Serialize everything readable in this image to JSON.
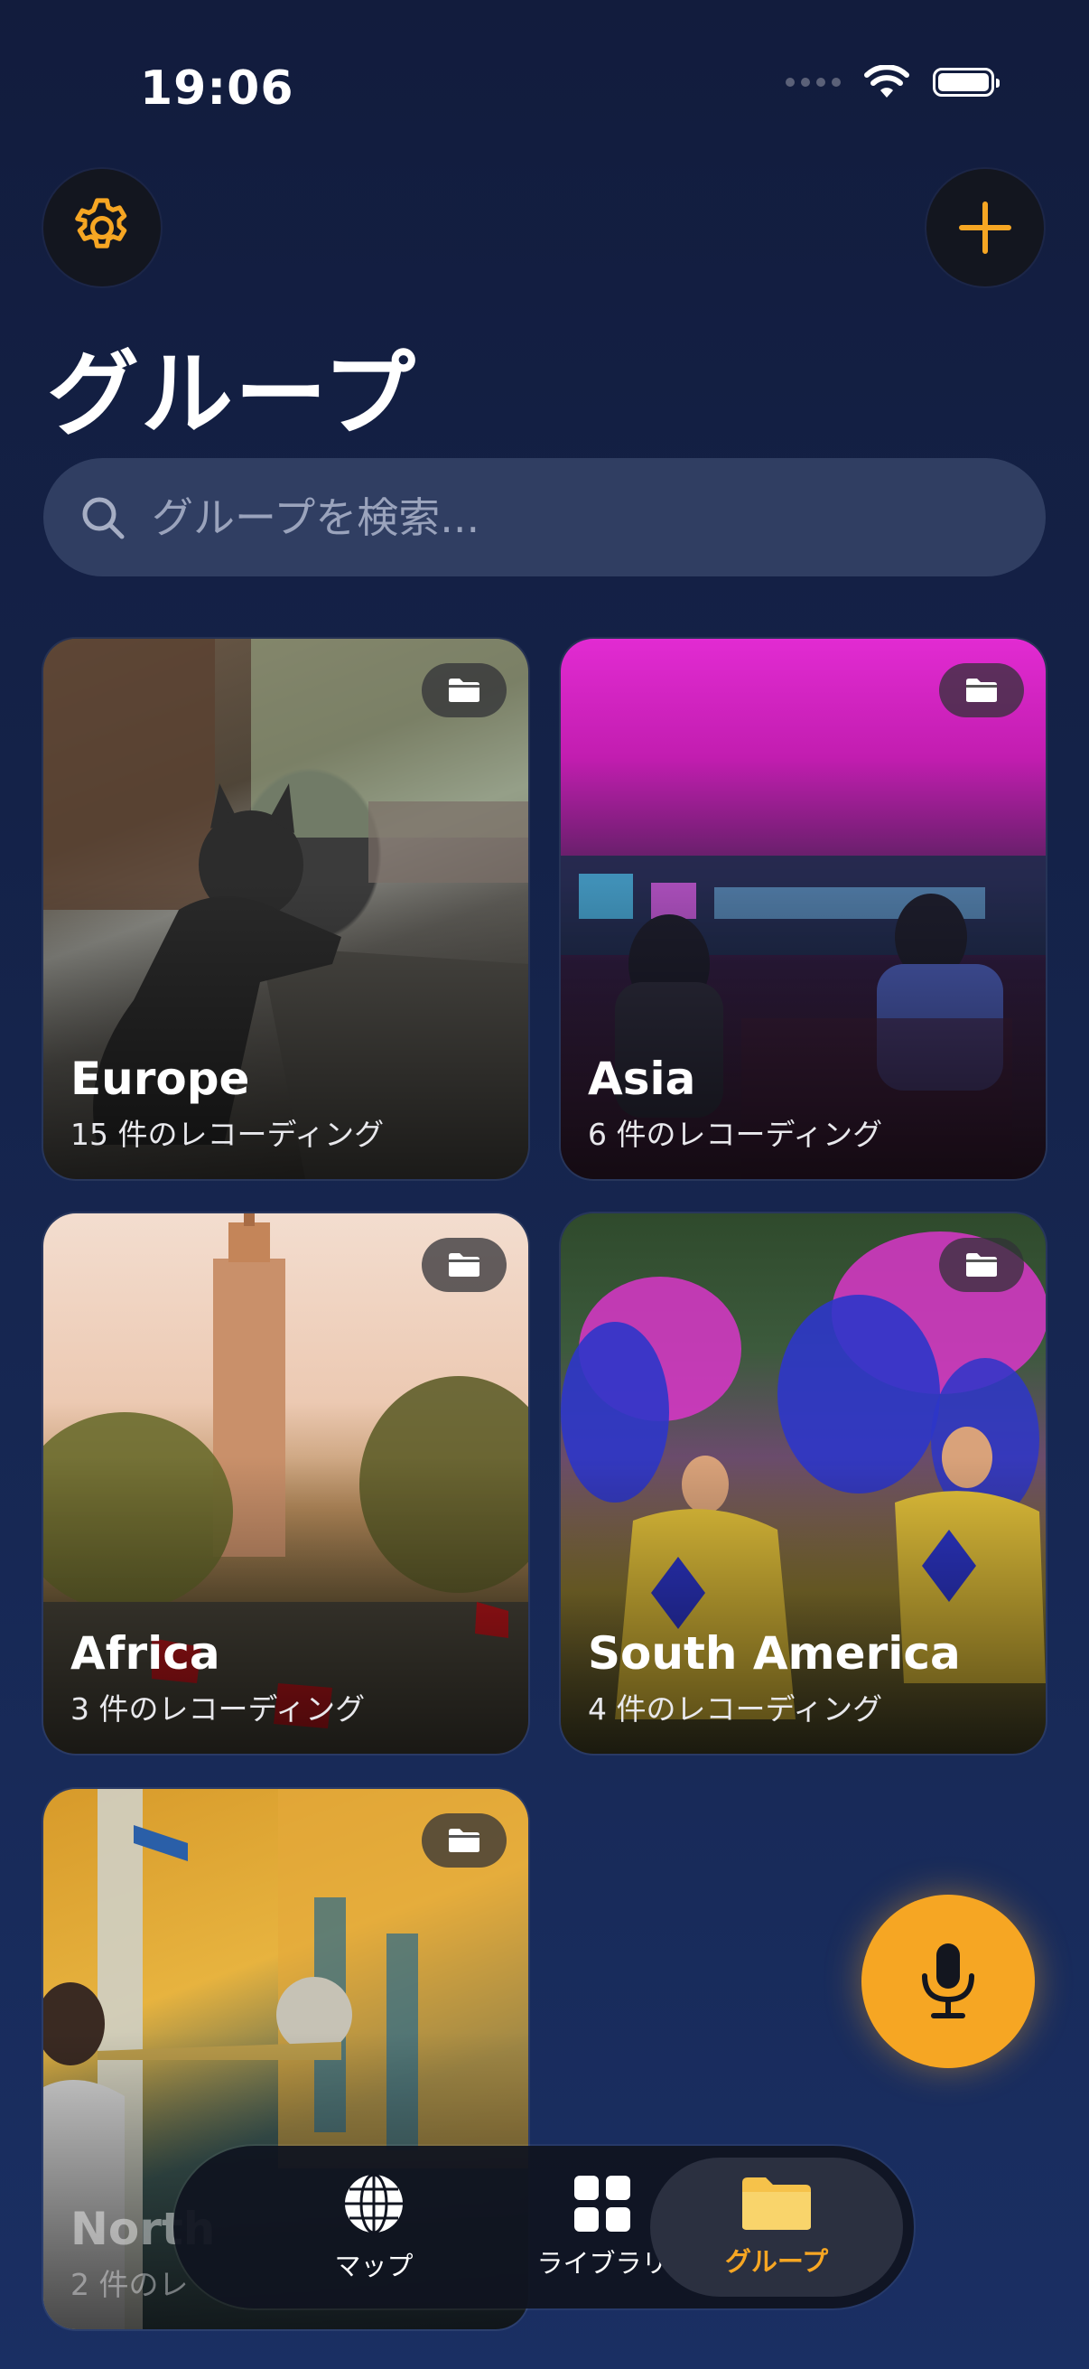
{
  "status_bar": {
    "time": "19:06"
  },
  "header": {
    "title": "グループ"
  },
  "search": {
    "placeholder": "グループを検索..."
  },
  "groups": [
    {
      "name": "Europe",
      "count": "15 件のレコーディング"
    },
    {
      "name": "Asia",
      "count": "6 件のレコーディング"
    },
    {
      "name": "Africa",
      "count": "3 件のレコーディング"
    },
    {
      "name": "South America",
      "count": "4 件のレコーディング"
    },
    {
      "name": "North",
      "count": "2 件のレ"
    }
  ],
  "tabbar": {
    "map": "マップ",
    "library": "ライブラリ",
    "group": "グループ"
  },
  "colors": {
    "accent": "#f6a623",
    "background": "#15244c"
  },
  "icons": [
    "gear-icon",
    "plus-icon",
    "search-icon",
    "folder-icon",
    "microphone-icon",
    "globe-icon",
    "grid-icon",
    "wifi-icon",
    "battery-icon"
  ]
}
